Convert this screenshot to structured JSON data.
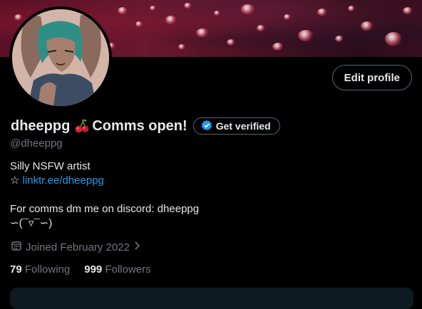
{
  "profile": {
    "display_name": "dheeppg",
    "display_name_suffix": "Comms open!",
    "handle": "@dheeppg",
    "edit_profile_label": "Edit profile",
    "get_verified_label": "Get verified",
    "bio": {
      "line1": "Silly NSFW artist",
      "link_prefix": "☆",
      "link_text": "linktr.ee/dheeppg",
      "line3": "For comms dm me on discord: dheeppg",
      "line4": "∽(¯▿¯∽)"
    },
    "joined_label": "Joined February 2022",
    "following_count": "79",
    "following_label": "Following",
    "followers_count": "999",
    "followers_label": "Followers"
  },
  "colors": {
    "accent": "#1d9bf0",
    "muted": "#71767b",
    "background": "#000000",
    "border": "#536471"
  },
  "icons": [
    "cherry-emoji-icon",
    "verified-badge-icon",
    "calendar-icon",
    "chevron-right-icon"
  ]
}
